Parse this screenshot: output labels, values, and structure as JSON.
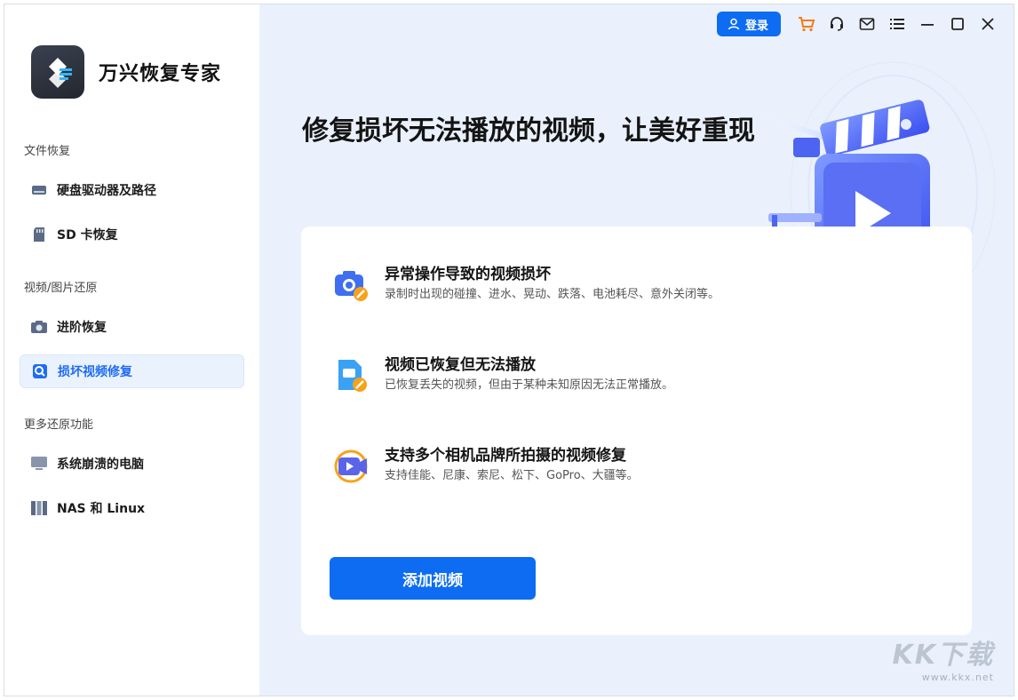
{
  "app": {
    "title": "万兴恢复专家"
  },
  "sidebar": {
    "sections": [
      {
        "label": "文件恢复"
      },
      {
        "label": "视频/图片还原"
      },
      {
        "label": "更多还原功能"
      }
    ],
    "items": [
      {
        "label": "硬盘驱动器及路径",
        "icon": "hard-drive-icon"
      },
      {
        "label": "SD 卡恢复",
        "icon": "sd-card-icon"
      },
      {
        "label": "进阶恢复",
        "icon": "camera-icon"
      },
      {
        "label": "损坏视频修复",
        "icon": "video-repair-icon",
        "active": true
      },
      {
        "label": "系统崩溃的电脑",
        "icon": "monitor-icon"
      },
      {
        "label": "NAS 和 Linux",
        "icon": "nas-icon"
      }
    ]
  },
  "topbar": {
    "login_label": "登录",
    "icons": [
      "cart-icon",
      "headset-icon",
      "mail-icon",
      "menu-icon",
      "minimize-icon",
      "maximize-icon",
      "close-icon"
    ]
  },
  "main": {
    "title": "修复损坏无法播放的视频，让美好重现",
    "features": [
      {
        "title": "异常操作导致的视频损坏",
        "desc": "录制时出现的碰撞、进水、晃动、跌落、电池耗尽、意外关闭等。"
      },
      {
        "title": "视频已恢复但无法播放",
        "desc": "已恢复丢失的视频，但由于某种未知原因无法正常播放。"
      },
      {
        "title": "支持多个相机品牌所拍摄的视频修复",
        "desc": "支持佳能、尼康、索尼、松下、GoPro、大疆等。"
      }
    ],
    "add_button": "添加视频"
  },
  "watermark": {
    "big": "KK下载",
    "small": "www.kkx.net"
  },
  "colors": {
    "accent": "#0d6cf2",
    "background": "#eaf1fc",
    "active_bg": "#eaf2fe"
  }
}
